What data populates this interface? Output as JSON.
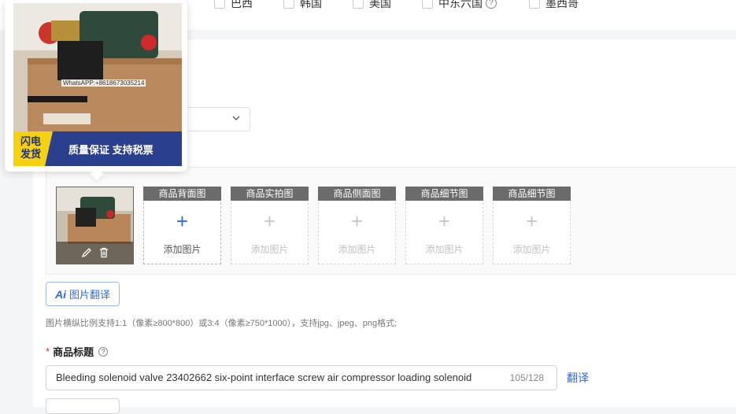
{
  "regions": [
    {
      "label": "巴西"
    },
    {
      "label": "韩国"
    },
    {
      "label": "美国"
    },
    {
      "label": "中东六国",
      "help": "?"
    },
    {
      "label": "墨西哥"
    }
  ],
  "popover": {
    "watermark": "WhatsAPP:+8618673035214",
    "banner_flash_line1": "闪电",
    "banner_flash_line2": "发货",
    "banner_slogan": "质量保证 支持税票"
  },
  "images": {
    "slots": [
      {
        "label": "商品背面图",
        "add_text": "添加图片",
        "active": true
      },
      {
        "label": "商品实拍图",
        "add_text": "添加图片",
        "active": false
      },
      {
        "label": "商品侧面图",
        "add_text": "添加图片",
        "active": false
      },
      {
        "label": "商品细节图",
        "add_text": "添加图片",
        "active": false
      },
      {
        "label": "商品细节图",
        "add_text": "添加图片",
        "active": false
      }
    ],
    "plus": "+",
    "ai_button": {
      "icon": "Ai",
      "label": "图片翻译"
    },
    "hint": "图片横纵比例支持1:1（像素≥800*800）或3:4（像素≥750*1000），支持jpg、jpeg、png格式;"
  },
  "title_field": {
    "required_mark": "*",
    "label": "商品标题",
    "help": "?",
    "value": "Bleeding solenoid valve 23402662 six-point interface screw air compressor loading solenoid",
    "count": "105/128",
    "translate": "翻译"
  },
  "colors": {
    "accent": "#2f6bdc",
    "required": "#e3382b",
    "banner": "#2b3f8f",
    "flash": "#f5d20f"
  }
}
